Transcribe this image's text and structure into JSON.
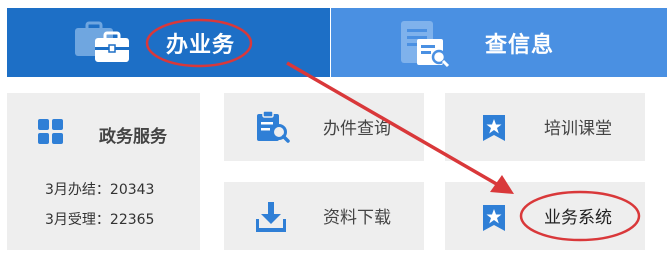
{
  "tabs": {
    "business": {
      "label": "办业务"
    },
    "info": {
      "label": "查信息"
    }
  },
  "stats_tile": {
    "title": "政务服务",
    "done_label": "3月办结：",
    "done_value": "20343",
    "accepted_label": "3月受理：",
    "accepted_value": "22365"
  },
  "tiles": {
    "query": {
      "label": "办件查询"
    },
    "download": {
      "label": "资料下载"
    },
    "classroom": {
      "label": "培训课堂"
    },
    "system": {
      "label": "业务系统"
    }
  },
  "colors": {
    "tab_active": "#1d6fc6",
    "tab_inactive": "#4a90e2",
    "tile_bg": "#eeeeee",
    "icon_blue": "#2f7fd6",
    "annotation_red": "#d9383a"
  },
  "icons": {
    "business_tab": "briefcase-icon",
    "info_tab": "document-search-icon",
    "stats": "grid-icon",
    "query": "clipboard-search-icon",
    "download": "download-icon",
    "classroom": "bookmark-star-icon",
    "system": "bookmark-star-icon"
  }
}
